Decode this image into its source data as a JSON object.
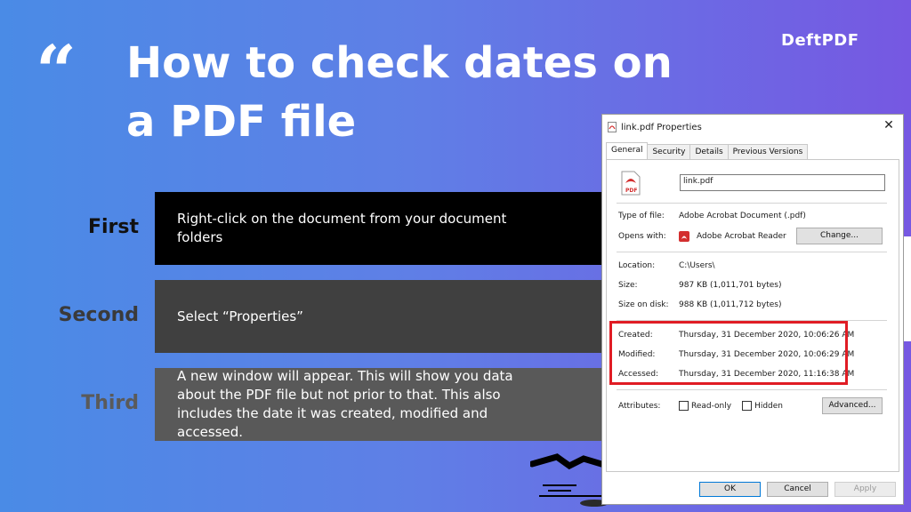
{
  "slide": {
    "quote_mark": "“",
    "title": "How to check dates on a PDF file",
    "brand": "DeftPDF"
  },
  "steps": [
    {
      "label": "First",
      "text": "Right-click on the document from your document folders",
      "label_color": "#111111",
      "box_color": "#000000"
    },
    {
      "label": "Second",
      "text": "Select “Properties”",
      "label_color": "#3a3a3a",
      "box_color": "#404040"
    },
    {
      "label": "Third",
      "text": "A new window will appear. This will show you data about the PDF file but not prior to that. This also includes the date it was created, modified and accessed.",
      "label_color": "#5a5a5a",
      "box_color": "#595959"
    }
  ],
  "dialog": {
    "title": "link.pdf Properties",
    "close_icon": "close-icon",
    "tabs": [
      "General",
      "Security",
      "Details",
      "Previous Versions"
    ],
    "active_tab": "General",
    "file_name": "link.pdf",
    "type_label": "Type of file:",
    "type_value": "Adobe Acrobat Document (.pdf)",
    "opens_label": "Opens with:",
    "opens_value": "Adobe Acrobat Reader D",
    "change_label": "Change...",
    "location_label": "Location:",
    "location_value": "C:\\Users\\",
    "size_label": "Size:",
    "size_value": "987 KB (1,011,701 bytes)",
    "size_disk_label": "Size on disk:",
    "size_disk_value": "988 KB (1,011,712 bytes)",
    "created_label": "Created:",
    "created_value": "Thursday, 31 December 2020, 10:06:26 AM",
    "modified_label": "Modified:",
    "modified_value": "Thursday, 31 December 2020, 10:06:29 AM",
    "accessed_label": "Accessed:",
    "accessed_value": "Thursday, 31 December 2020, 11:16:38 AM",
    "attributes_label": "Attributes:",
    "readonly_label": "Read-only",
    "hidden_label": "Hidden",
    "advanced_label": "Advanced...",
    "ok_label": "OK",
    "cancel_label": "Cancel",
    "apply_label": "Apply"
  },
  "colors": {
    "highlight": "#e01c24",
    "pdf_red": "#d32f2f"
  }
}
